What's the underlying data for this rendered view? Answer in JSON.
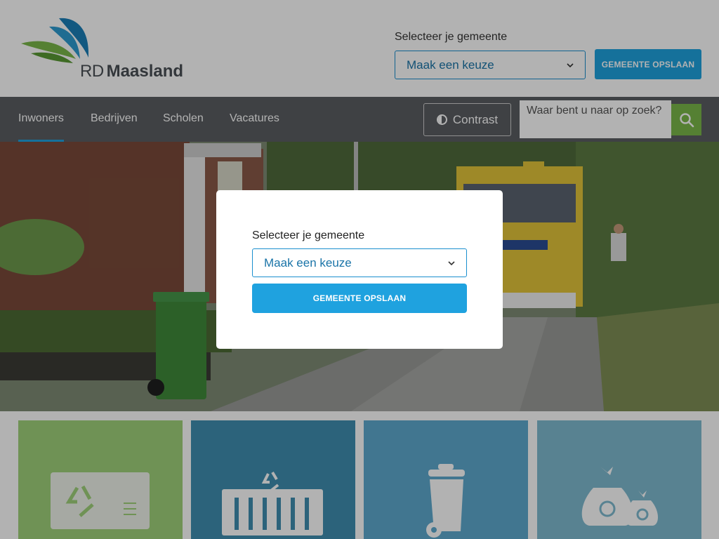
{
  "header": {
    "logo_text_rd": "RD",
    "logo_text_name": "Maasland",
    "municipality_label": "Selecteer je gemeente",
    "municipality_select_value": "Maak een keuze",
    "save_button_label": "GEMEENTE OPSLAAN"
  },
  "nav": {
    "items": [
      {
        "label": "Inwoners",
        "active": true
      },
      {
        "label": "Bedrijven",
        "active": false
      },
      {
        "label": "Scholen",
        "active": false
      },
      {
        "label": "Vacatures",
        "active": false
      }
    ],
    "contrast_label": "Contrast",
    "search_placeholder": "Waar bent u naar op zoek?"
  },
  "modal": {
    "label": "Selecteer je gemeente",
    "select_value": "Maak een keuze",
    "save_button_label": "GEMEENTE OPSLAAN"
  },
  "tiles": [
    {
      "icon": "recycle-bin-icon",
      "color": "#9fd27a"
    },
    {
      "icon": "container-icon",
      "color": "#3f8fb0"
    },
    {
      "icon": "wheelie-bin-icon",
      "color": "#5ea9cf"
    },
    {
      "icon": "garbage-bags-icon",
      "color": "#7fbad0"
    }
  ],
  "colors": {
    "accent": "#1fa2df",
    "nav_bg": "#5b5e62",
    "search_button": "#7ab84a"
  }
}
